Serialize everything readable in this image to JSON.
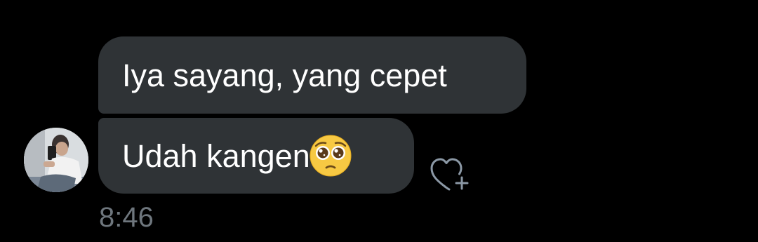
{
  "messages": [
    {
      "text": "Iya sayang, yang cepet"
    },
    {
      "text": "Udah kangen",
      "emoji": "pleading-face-emoji"
    }
  ],
  "timestamp": "8:46",
  "icons": {
    "avatar": "user-avatar",
    "react": "heart-plus-icon"
  },
  "colors": {
    "background": "#000000",
    "bubble": "#2f3336",
    "text": "#ffffff",
    "timestamp": "#6e767d",
    "icon": "#8b98a5"
  }
}
